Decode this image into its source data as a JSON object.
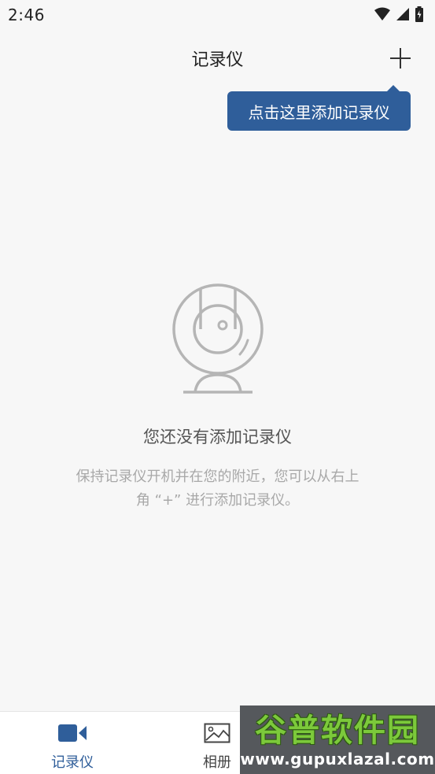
{
  "status_bar": {
    "time": "2:46"
  },
  "header": {
    "title": "记录仪",
    "add_icon": "plus-icon"
  },
  "tooltip": {
    "text": "点击这里添加记录仪"
  },
  "empty_state": {
    "icon": "webcam-icon",
    "title": "您还没有添加记录仪",
    "description": "保持记录仪开机并在您的附近，您可以从右上角 “+” 进行添加记录仪。"
  },
  "tab_bar": {
    "tabs": [
      {
        "label": "记录仪",
        "icon": "video-camera-icon",
        "active": true
      },
      {
        "label": "相册",
        "icon": "image-icon",
        "active": false
      }
    ],
    "active_color": "#2f5e9a"
  },
  "watermark": {
    "title": "谷普软件园",
    "url": "www.gupuxlazal.com"
  },
  "colors": {
    "accent": "#2f5e9a",
    "background": "#f7f7f7"
  }
}
